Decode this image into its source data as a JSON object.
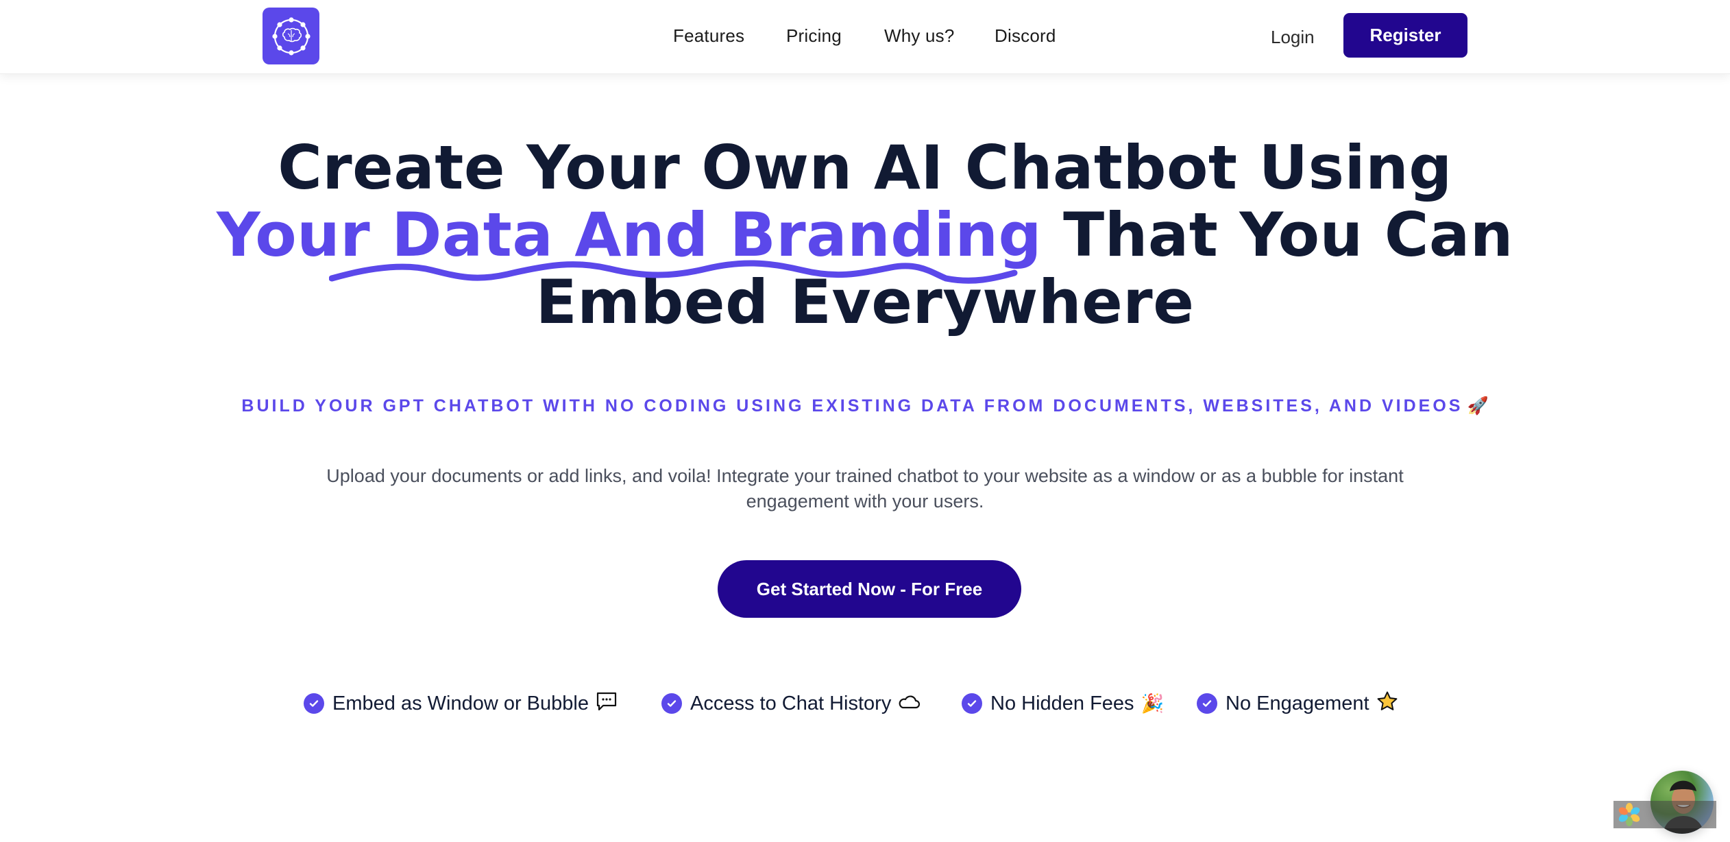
{
  "header": {
    "logo_icon": "brain-network-icon",
    "nav": [
      {
        "label": "Features"
      },
      {
        "label": "Pricing"
      },
      {
        "label": "Why us?"
      },
      {
        "label": "Discord"
      }
    ],
    "login_label": "Login",
    "register_label": "Register"
  },
  "hero": {
    "title_line1": "Create Your Own AI Chatbot Using",
    "title_highlight": "Your Data And Branding",
    "title_line2_rest": " That You Can",
    "title_line3": "Embed Everywhere",
    "tagline": "BUILD YOUR GPT CHATBOT WITH NO CODING USING EXISTING DATA FROM DOCUMENTS, WEBSITES, AND VIDEOS",
    "tagline_emoji": "🚀",
    "description": "Upload your documents or add links, and voila! Integrate your trained chatbot to your website as a window or as a bubble for instant engagement with your users.",
    "cta_label": "Get Started Now - For Free"
  },
  "features": [
    {
      "label": "Embed as Window or Bubble",
      "emoji": "💬",
      "icon": "speech-bubble-icon"
    },
    {
      "label": "Access to Chat History",
      "emoji": "☁",
      "icon": "cloud-icon"
    },
    {
      "label": "No Hidden Fees",
      "emoji": "🎉",
      "icon": "party-popper-icon"
    },
    {
      "label": "No Engagement",
      "emoji": "⭐",
      "icon": "star-icon"
    }
  ],
  "colors": {
    "brand": "#5b48ea",
    "primary_button": "#22068f",
    "heading": "#111a33",
    "body_text": "#4a4f5c"
  }
}
